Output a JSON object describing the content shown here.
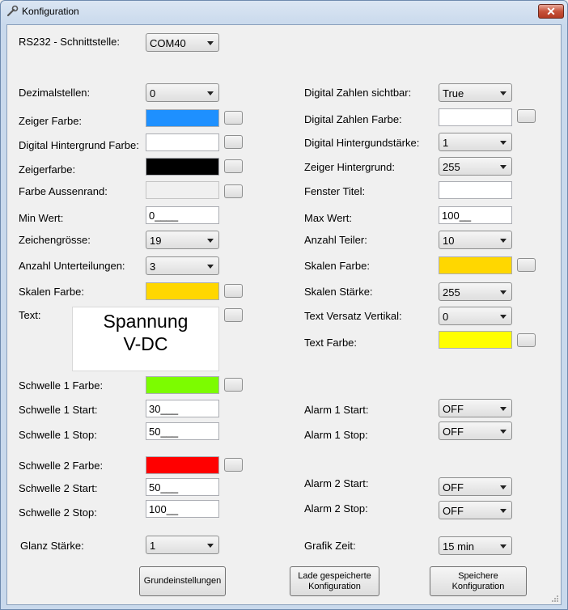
{
  "window": {
    "title": "Konfiguration",
    "close_label": "✕"
  },
  "rs232": {
    "label": "RS232 - Schnittstelle:",
    "value": "COM40"
  },
  "left": {
    "dezimalstellen": {
      "label": "Dezimalstellen:",
      "value": "0"
    },
    "zeiger_farbe": {
      "label": "Zeiger Farbe:",
      "color": "#1e90ff"
    },
    "digital_hintergrund_farbe": {
      "label": "Digital Hintergrund Farbe:",
      "color": "#ffffff"
    },
    "zeigerfarbe": {
      "label": "Zeigerfarbe:",
      "color": "#000000"
    },
    "farbe_aussenrand": {
      "label": "Farbe Aussenrand:",
      "color": "#f0f0f0"
    },
    "min_wert": {
      "label": "Min Wert:",
      "value": "0____"
    },
    "zeichengroesse": {
      "label": "Zeichengrösse:",
      "value": "19"
    },
    "anzahl_unterteilungen": {
      "label": "Anzahl Unterteilungen:",
      "value": "3"
    },
    "skalen_farbe": {
      "label": "Skalen Farbe:",
      "color": "#ffd700"
    },
    "text": {
      "label": "Text:",
      "line1": "Spannung",
      "line2": "V-DC"
    },
    "schwelle1_farbe": {
      "label": "Schwelle 1 Farbe:",
      "color": "#7cfc00"
    },
    "schwelle1_start": {
      "label": "Schwelle 1 Start:",
      "value": "30___"
    },
    "schwelle1_stop": {
      "label": "Schwelle 1 Stop:",
      "value": "50___"
    },
    "schwelle2_farbe": {
      "label": "Schwelle 2 Farbe:",
      "color": "#ff0000"
    },
    "schwelle2_start": {
      "label": "Schwelle 2 Start:",
      "value": "50___"
    },
    "schwelle2_stop": {
      "label": "Schwelle 2 Stop:",
      "value": "100__"
    },
    "glanz_staerke": {
      "label": "Glanz Stärke:",
      "value": "1"
    }
  },
  "right": {
    "digital_zahlen_sichtbar": {
      "label": "Digital Zahlen sichtbar:",
      "value": "True"
    },
    "digital_zahlen_farbe": {
      "label": "Digital Zahlen Farbe:",
      "color": "#ffffff"
    },
    "digital_hintergrundstaerke": {
      "label": "Digital Hintergundstärke:",
      "value": "1"
    },
    "zeiger_hintergrund": {
      "label": "Zeiger Hintergrund:",
      "value": "255"
    },
    "fenster_titel": {
      "label": "Fenster Titel:",
      "value": ""
    },
    "max_wert": {
      "label": "Max Wert:",
      "value": "100__"
    },
    "anzahl_teiler": {
      "label": "Anzahl Teiler:",
      "value": "10"
    },
    "skalen_farbe": {
      "label": "Skalen Farbe:",
      "color": "#ffd700"
    },
    "skalen_staerke": {
      "label": "Skalen Stärke:",
      "value": "255"
    },
    "text_versatz_vertikal": {
      "label": "Text Versatz Vertikal:",
      "value": "0"
    },
    "text_farbe": {
      "label": "Text Farbe:",
      "color": "#ffff00"
    },
    "alarm1_start": {
      "label": "Alarm 1 Start:",
      "value": "OFF"
    },
    "alarm1_stop": {
      "label": "Alarm 1 Stop:",
      "value": "OFF"
    },
    "alarm2_start": {
      "label": "Alarm 2 Start:",
      "value": "OFF"
    },
    "alarm2_stop": {
      "label": "Alarm 2 Stop:",
      "value": "OFF"
    },
    "grafik_zeit": {
      "label": "Grafik Zeit:",
      "value": "15 min"
    }
  },
  "buttons": {
    "grundeinstellungen": "Grundeinstellungen",
    "lade": "Lade gespeicherte Konfiguration",
    "speichere": "Speichere Konfiguration"
  }
}
